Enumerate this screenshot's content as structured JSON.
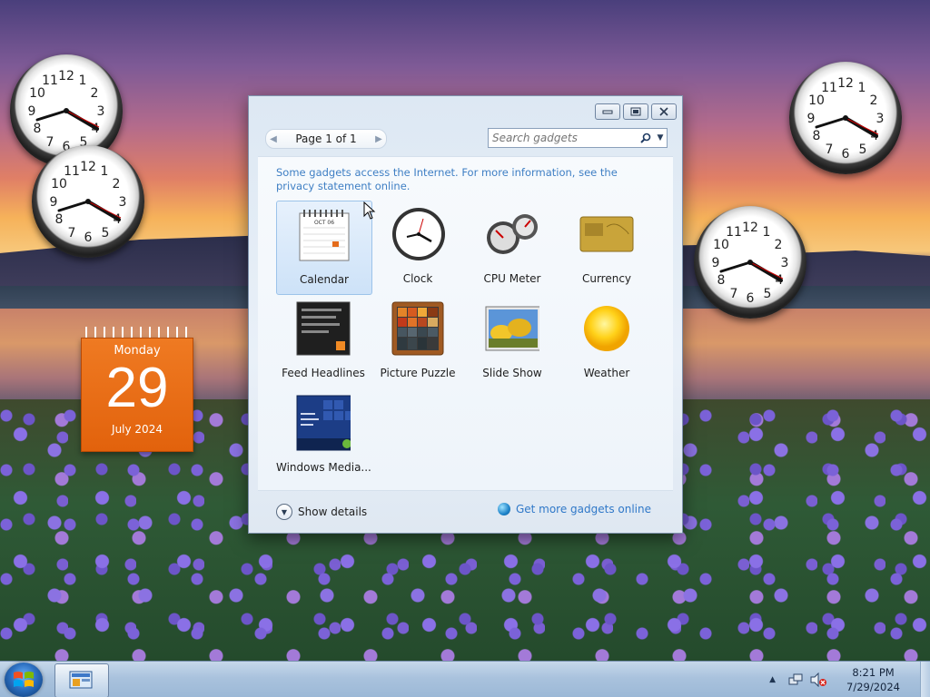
{
  "desktop": {
    "calendar_gadget": {
      "day_name": "Monday",
      "date": "29",
      "month_year": "July 2024"
    }
  },
  "gallery": {
    "pager": {
      "text": "Page 1 of 1"
    },
    "search": {
      "placeholder": "Search gadgets"
    },
    "notice": "Some gadgets access the Internet.  For more information, see the privacy statement online.",
    "gadgets": [
      {
        "label": "Calendar",
        "icon": "calendar-icon",
        "selected": true
      },
      {
        "label": "Clock",
        "icon": "clock-icon"
      },
      {
        "label": "CPU Meter",
        "icon": "cpu-meter-icon"
      },
      {
        "label": "Currency",
        "icon": "currency-icon"
      },
      {
        "label": "Feed Headlines",
        "icon": "feed-headlines-icon"
      },
      {
        "label": "Picture Puzzle",
        "icon": "picture-puzzle-icon"
      },
      {
        "label": "Slide Show",
        "icon": "slide-show-icon"
      },
      {
        "label": "Weather",
        "icon": "weather-icon"
      },
      {
        "label": "Windows Media...",
        "icon": "windows-media-icon"
      }
    ],
    "calendar_icon_month": "OCT 06",
    "footer": {
      "show_details": "Show details",
      "get_more": "Get more gadgets online"
    }
  },
  "taskbar": {
    "time": "8:21 PM",
    "date": "7/29/2024"
  },
  "colors": {
    "accent_link": "#3e7fc4",
    "calendar_orange": "#e2620c"
  }
}
